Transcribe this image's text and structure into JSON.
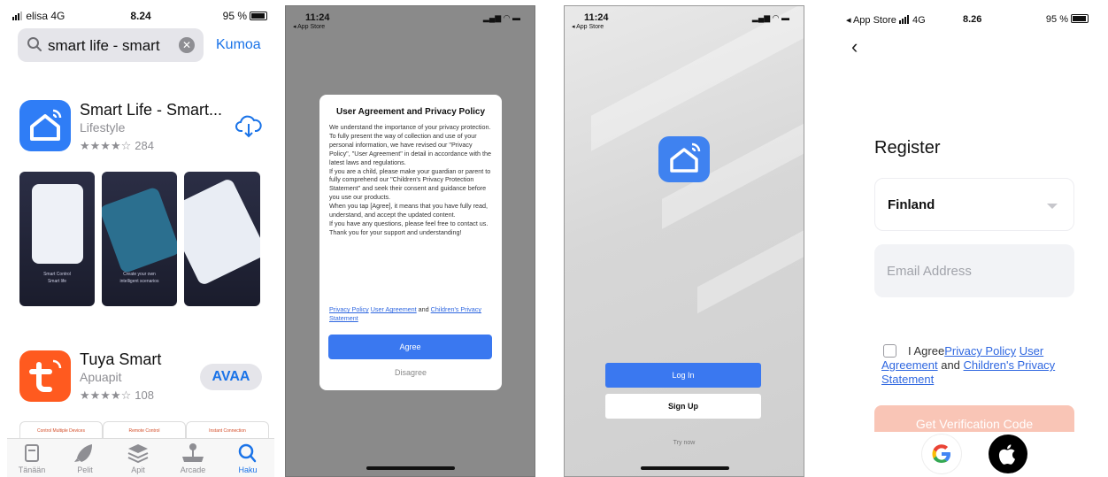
{
  "appstore": {
    "status": {
      "carrier": "elisa",
      "network": "4G",
      "time": "8.24",
      "battery": "95 %"
    },
    "search": {
      "query": "smart life - smart",
      "cancel": "Kumoa"
    },
    "results": [
      {
        "title": "Smart Life - Smart...",
        "category": "Lifestyle",
        "stars": "★★★★☆",
        "count": "284"
      },
      {
        "title": "Tuya Smart",
        "category": "Apuapit",
        "stars": "★★★★☆",
        "count": "108",
        "action": "AVAA"
      }
    ],
    "screenshots": [
      {
        "caption": "Smart Control\nSmart life"
      },
      {
        "caption": "Create your own\nintelligent scenarios"
      },
      {
        "caption": ""
      }
    ],
    "promos": [
      "Control Multiple Devices",
      "Remote Control",
      "Instant Connection"
    ],
    "tabs": [
      "Tänään",
      "Pelit",
      "Apit",
      "Arcade",
      "Haku"
    ],
    "colors": {
      "accent": "#1a73e8",
      "smart_life_blue": "#2f7df6",
      "tuya_orange": "#ff5a1f"
    }
  },
  "dialog": {
    "status": {
      "time": "11:24",
      "back": "◂ App Store"
    },
    "title": "User Agreement and Privacy Policy",
    "body": [
      "We understand the importance of your privacy protection. To fully present the way of collection and use of your personal information, we have revised our \"Privacy Policy\", \"User Agreement\" in detail in accordance with the latest laws and regulations.",
      "If you are a child, please make your guardian or parent to fully comprehend our \"Children's Privacy Protection Statement\" and seek their consent and guidance before you use our products.",
      "When you tap [Agree], it means that you have fully read, understand, and accept the updated content.",
      "If you have any questions, please feel free to contact us.",
      "Thank you for your support and understanding!"
    ],
    "link_privacy": "Privacy Policy",
    "link_user": "User Agreement",
    "link_and": "and",
    "link_children": "Children's Privacy Statement",
    "agree": "Agree",
    "disagree": "Disagree"
  },
  "login": {
    "status": {
      "time": "11:24",
      "back": "◂ App Store"
    },
    "login": "Log In",
    "signup": "Sign Up",
    "trynow": "Try now"
  },
  "register": {
    "status": {
      "back": "◂ App Store",
      "network": "4G",
      "time": "8.26",
      "battery": "95 %"
    },
    "title": "Register",
    "country": "Finland",
    "email_placeholder": "Email Address",
    "agree_prefix": "I Agree",
    "link_privacy": "Privacy Policy",
    "link_user": "User Agreement",
    "agree_and": "and",
    "link_children": "Children's Privacy Statement",
    "verify": "Get Verification Code",
    "colors": {
      "verify_bg": "#f9c5b6",
      "link": "#2f67e0"
    }
  }
}
